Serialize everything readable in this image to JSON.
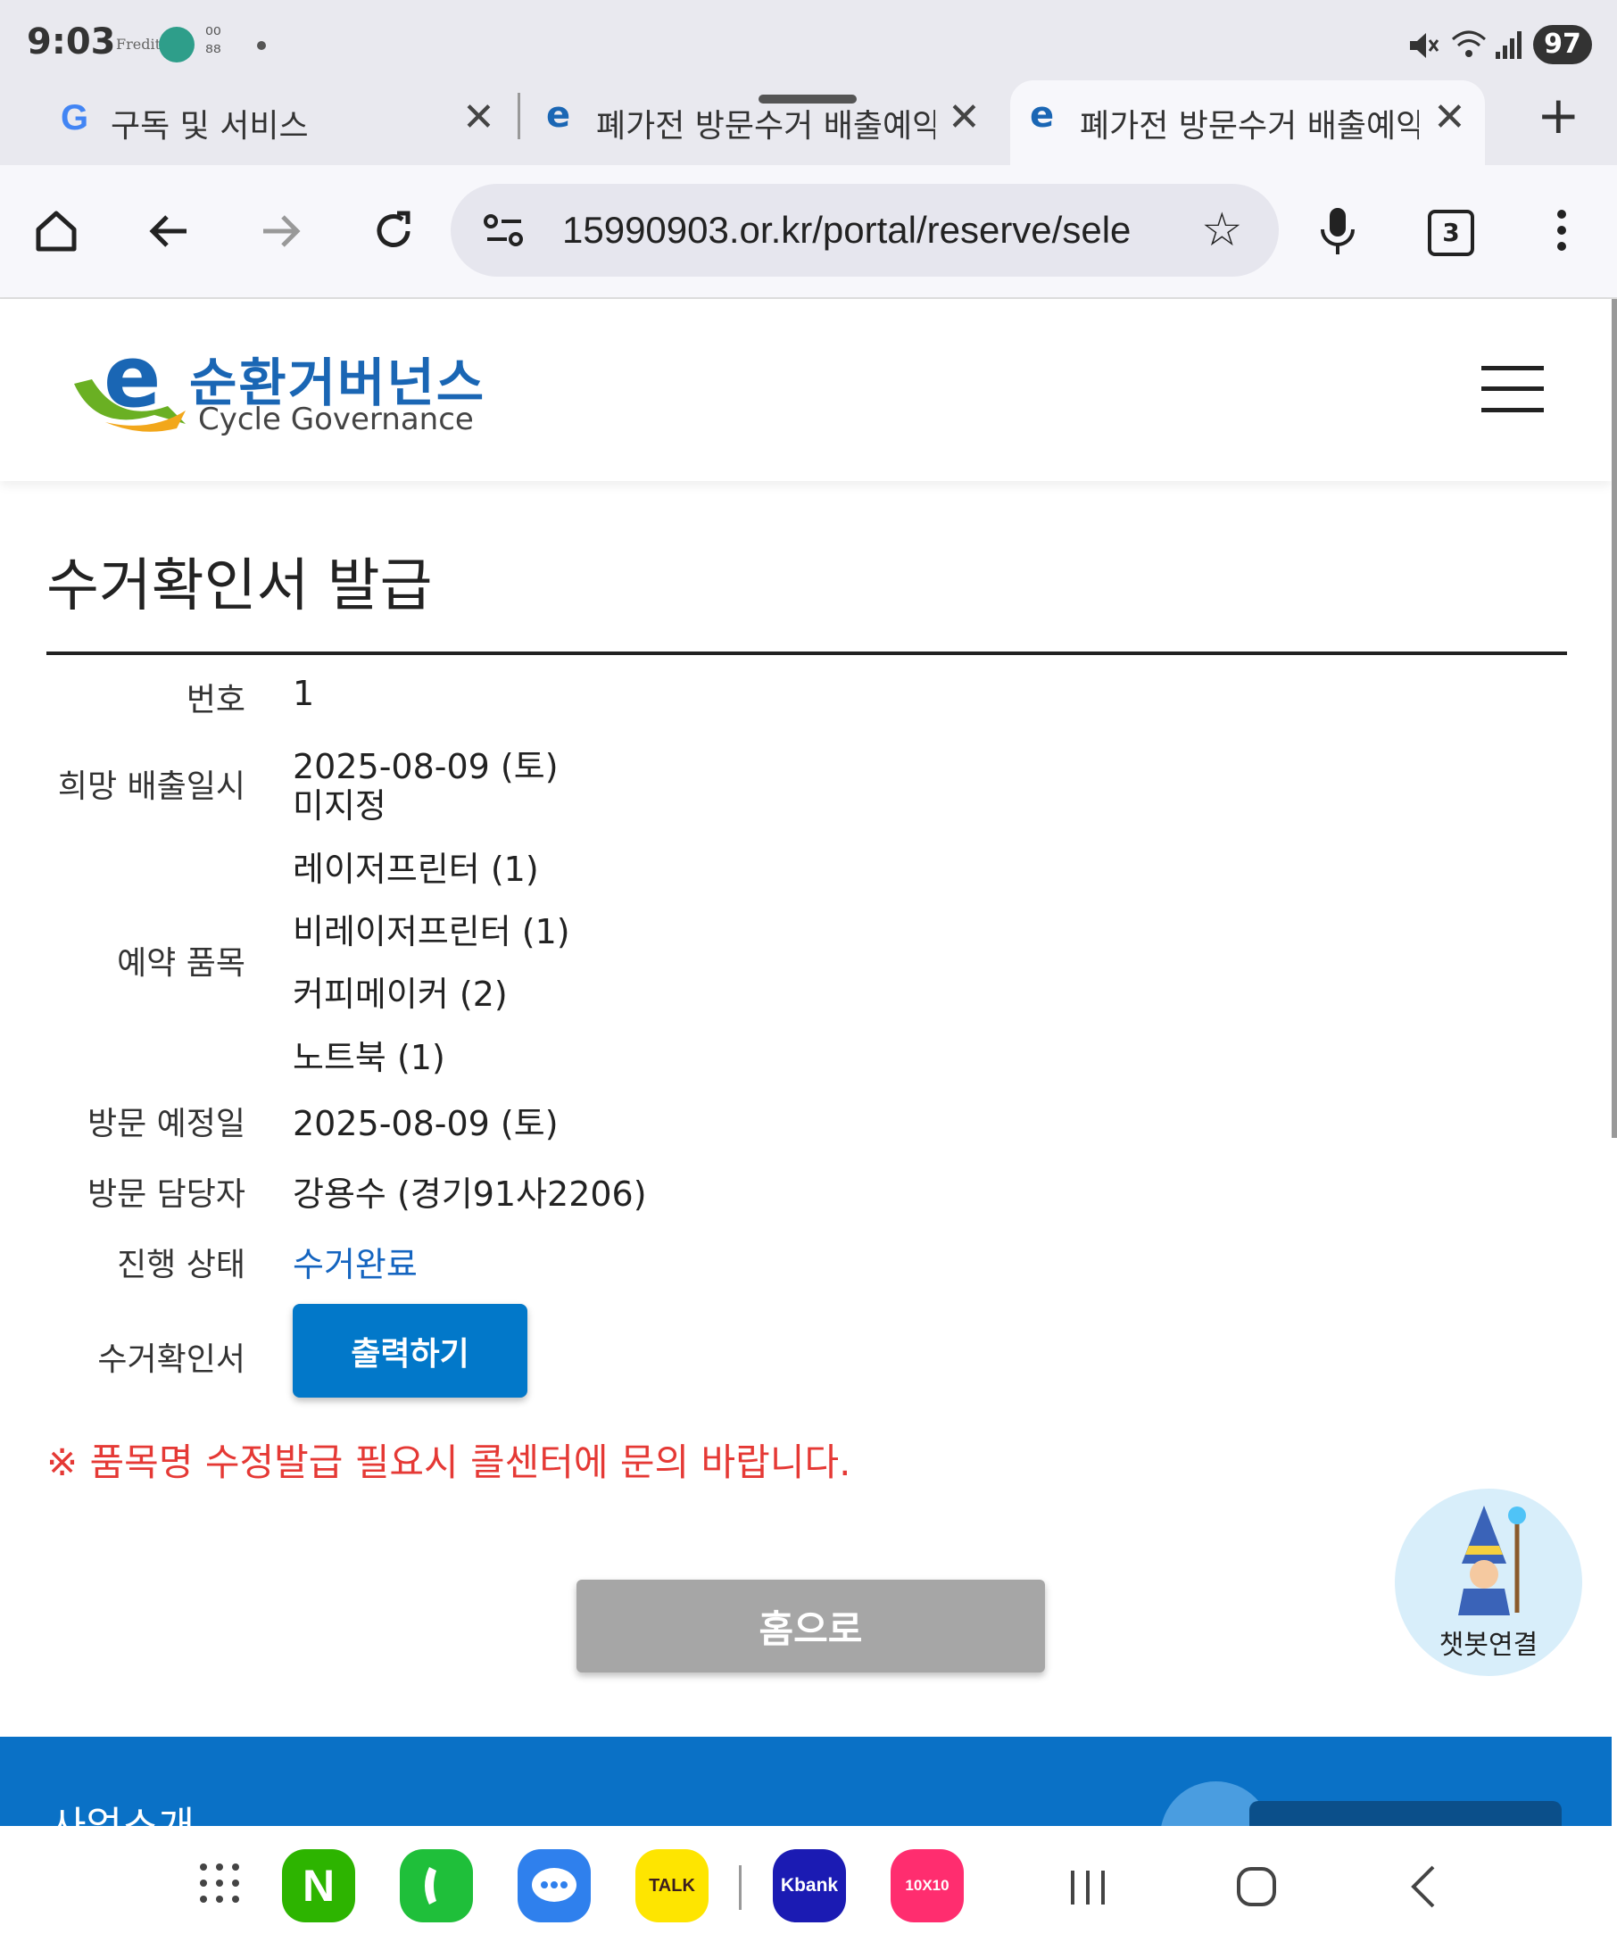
{
  "status_bar": {
    "time": "9:03",
    "notification_app": "Fredit",
    "battery": "97"
  },
  "tabs": [
    {
      "title": "구독 및 서비스"
    },
    {
      "title": "폐가전 방문수거 배출예약시"
    },
    {
      "title": "폐가전 방문수거 배출예약시"
    }
  ],
  "toolbar": {
    "url": "15990903.or.kr/portal/reserve/sele",
    "tab_count": "3"
  },
  "site": {
    "logo_kr": "순환거버넌스",
    "logo_en": "Cycle Governance"
  },
  "page": {
    "title": "수거확인서 발급",
    "rows": {
      "number": {
        "label": "번호",
        "value": "1"
      },
      "desired_date": {
        "label": "희망 배출일시",
        "value": "2025-08-09 (토)",
        "value2": "미지정"
      },
      "items": {
        "label": "예약 품목",
        "values": [
          "레이저프린터 (1)",
          "비레이저프린터 (1)",
          "커피메이커 (2)",
          "노트북 (1)"
        ]
      },
      "visit_date": {
        "label": "방문 예정일",
        "value": "2025-08-09 (토)"
      },
      "visitor": {
        "label": "방문 담당자",
        "value": "강용수 (경기91사2206)"
      },
      "status": {
        "label": "진행 상태",
        "value": "수거완료"
      },
      "certificate": {
        "label": "수거확인서",
        "button": "출력하기"
      }
    },
    "notice": "※ 품목명 수정발급 필요시 콜센터에 문의 바랍니다.",
    "home_button": "홈으로",
    "chatbot_label": "챗봇연결"
  },
  "footer": {
    "section_title": "사업소개"
  },
  "dock": {
    "apps": [
      "N",
      "TALK",
      "Kbank",
      "10X10"
    ]
  },
  "colors": {
    "primary_button": "#0278c9",
    "status_blue": "#1565c0",
    "notice_red": "#e53935",
    "footer_blue": "#0a71c6"
  }
}
